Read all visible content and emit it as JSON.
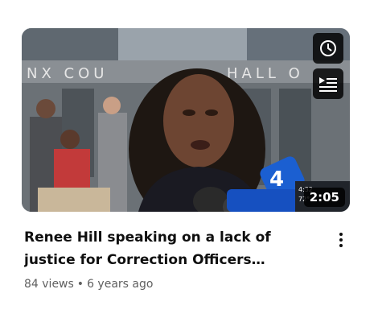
{
  "video": {
    "title": "Renee Hill speaking on a lack of justice for Correction Officers sentenced in Rikers…",
    "duration": "2:05",
    "views": "84 views",
    "separator": "•",
    "age": "6 years ago",
    "thumbnail": {
      "building_sign_left": "NX COU",
      "building_sign_right": "HALL O",
      "mic_logo": "4",
      "mic_weather_time": "4:32",
      "mic_weather_temp": "72°"
    }
  },
  "icons": {
    "watch_later": "clock-icon",
    "add_to_queue": "queue-icon",
    "more_actions": "kebab-icon"
  },
  "colors": {
    "title": "#0f0f0f",
    "meta": "#606060",
    "overlay": "#000000",
    "mic_blue": "#1b5fd1"
  }
}
